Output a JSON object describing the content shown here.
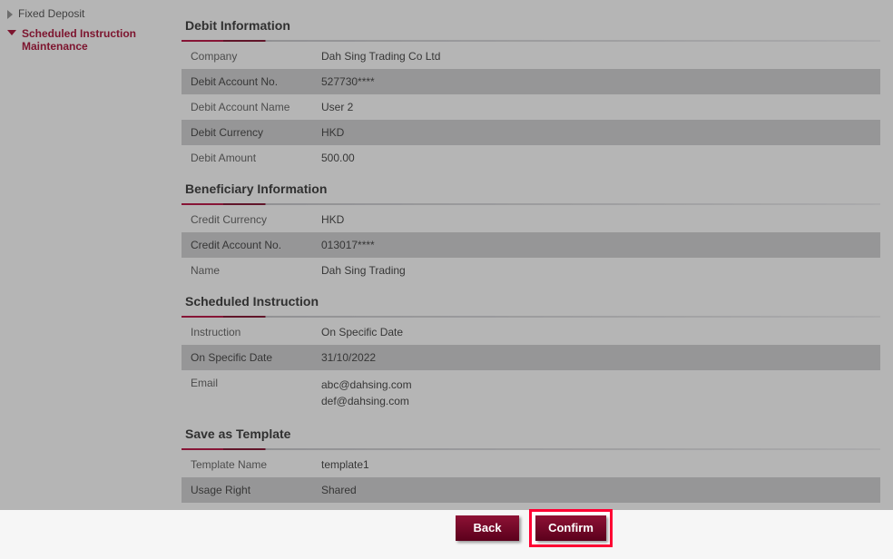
{
  "sidebar": {
    "items": [
      {
        "label": "Fixed Deposit",
        "active": false
      },
      {
        "label": "Scheduled Instruction Maintenance",
        "active": true
      }
    ]
  },
  "sections": {
    "debit": {
      "title": "Debit Information",
      "rows": [
        {
          "k": "Company",
          "v": "Dah Sing Trading Co Ltd"
        },
        {
          "k": "Debit Account No.",
          "v": "527730****"
        },
        {
          "k": "Debit Account Name",
          "v": "User 2"
        },
        {
          "k": "Debit Currency",
          "v": "HKD"
        },
        {
          "k": "Debit Amount",
          "v": "500.00"
        }
      ]
    },
    "beneficiary": {
      "title": "Beneficiary Information",
      "rows": [
        {
          "k": "Credit Currency",
          "v": "HKD"
        },
        {
          "k": "Credit Account No.",
          "v": "013017****"
        },
        {
          "k": "Name",
          "v": "Dah Sing Trading"
        }
      ]
    },
    "scheduled": {
      "title": "Scheduled Instruction",
      "rows": [
        {
          "k": "Instruction",
          "v": "On Specific Date"
        },
        {
          "k": "On Specific Date",
          "v": "31/10/2022"
        },
        {
          "k": "Email",
          "v": [
            "abc@dahsing.com",
            "def@dahsing.com"
          ]
        }
      ]
    },
    "template": {
      "title": "Save as Template",
      "rows": [
        {
          "k": "Template Name",
          "v": "template1"
        },
        {
          "k": "Usage Right",
          "v": "Shared"
        }
      ]
    }
  },
  "buttons": {
    "back": "Back",
    "confirm": "Confirm"
  },
  "colors": {
    "brand": "#a00028",
    "highlight": "#ff0033"
  }
}
